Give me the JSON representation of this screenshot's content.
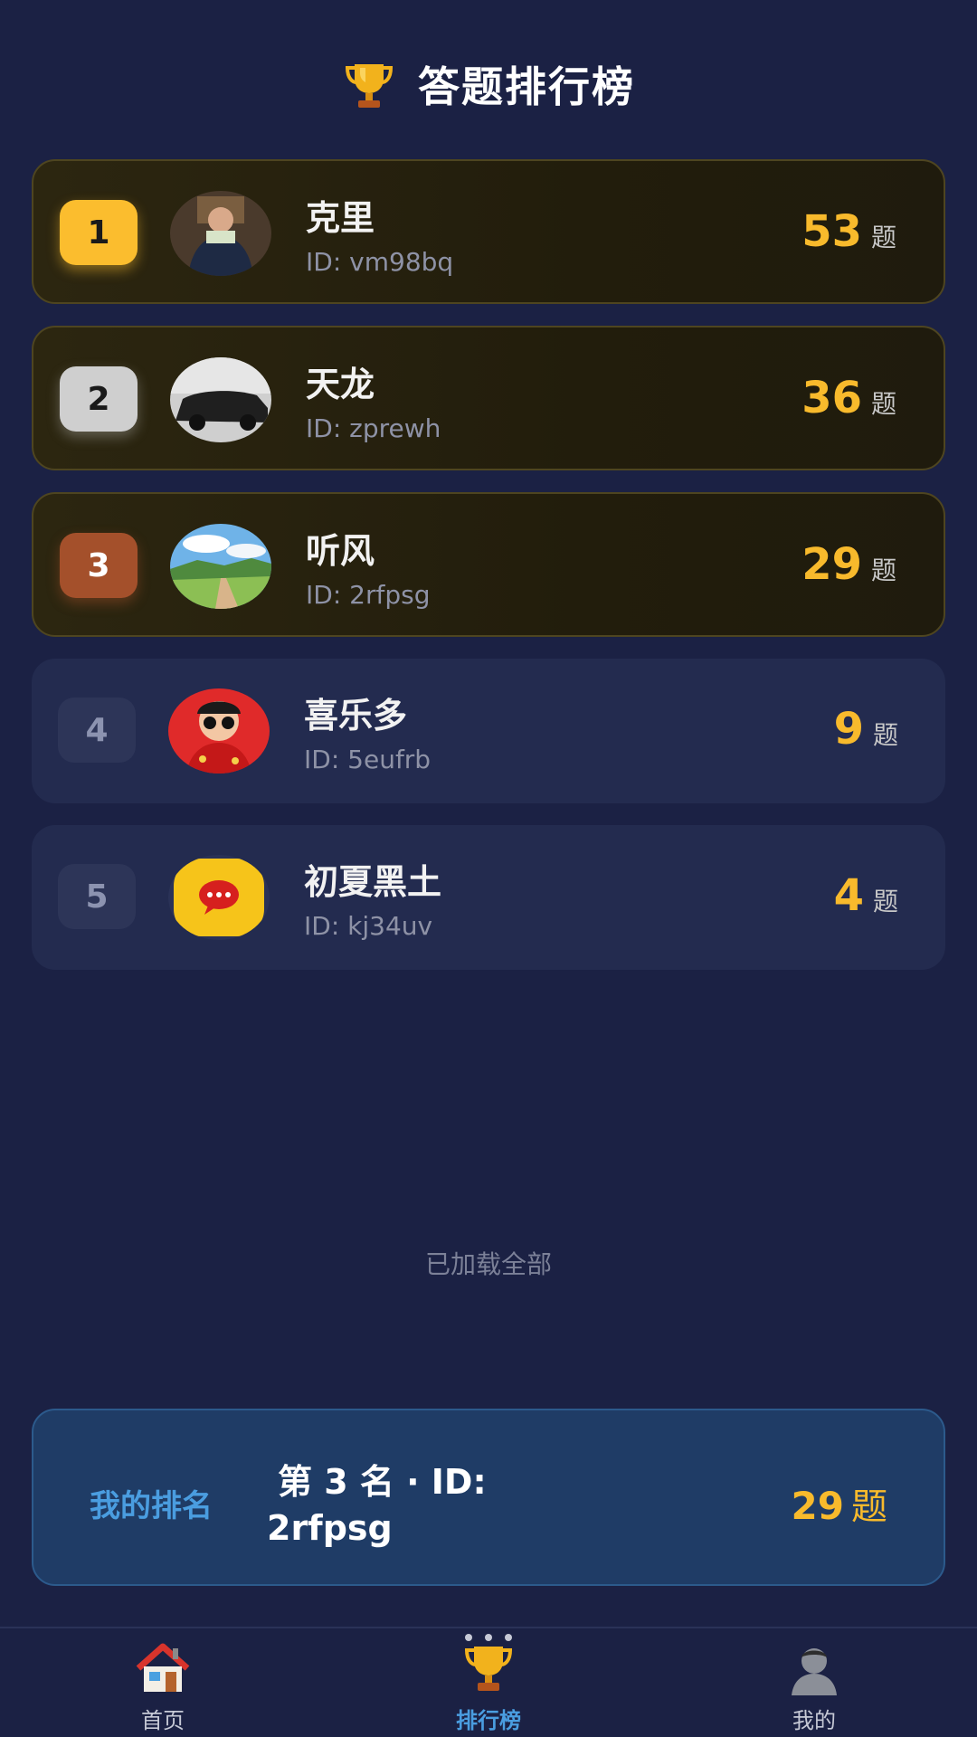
{
  "header": {
    "title": "答题排行榜",
    "icon": "trophy-icon"
  },
  "ranking": [
    {
      "rank": "1",
      "name": "克里",
      "id": "ID: vm98bq",
      "score": "53",
      "unit": "题",
      "avatar": "photo-man-avatar"
    },
    {
      "rank": "2",
      "name": "天龙",
      "id": "ID: zprewh",
      "score": "36",
      "unit": "题",
      "avatar": "car-avatar"
    },
    {
      "rank": "3",
      "name": "听风",
      "id": "ID: 2rfpsg",
      "score": "29",
      "unit": "题",
      "avatar": "landscape-avatar"
    },
    {
      "rank": "4",
      "name": "喜乐多",
      "id": "ID: 5eufrb",
      "score": "9",
      "unit": "题",
      "avatar": "cartoon-avatar"
    },
    {
      "rank": "5",
      "name": "初夏黑土",
      "id": "ID: kj34uv",
      "score": "4",
      "unit": "题",
      "avatar": "chat-bubble-avatar"
    }
  ],
  "loaded_text": "已加载全部",
  "my_rank": {
    "label": "我的排名",
    "line1": "第 3 名 · ID:",
    "line2": "2rfpsg",
    "score": "29",
    "unit": "题"
  },
  "nav": {
    "home": "首页",
    "ranking": "排行榜",
    "mine": "我的"
  },
  "colors": {
    "background": "#1b2144",
    "accent_gold": "#f8ba2c",
    "accent_blue": "#4a9de0",
    "rank1": "#fbbd2e",
    "rank2": "#cfcfcf",
    "rank3": "#a4502b"
  }
}
